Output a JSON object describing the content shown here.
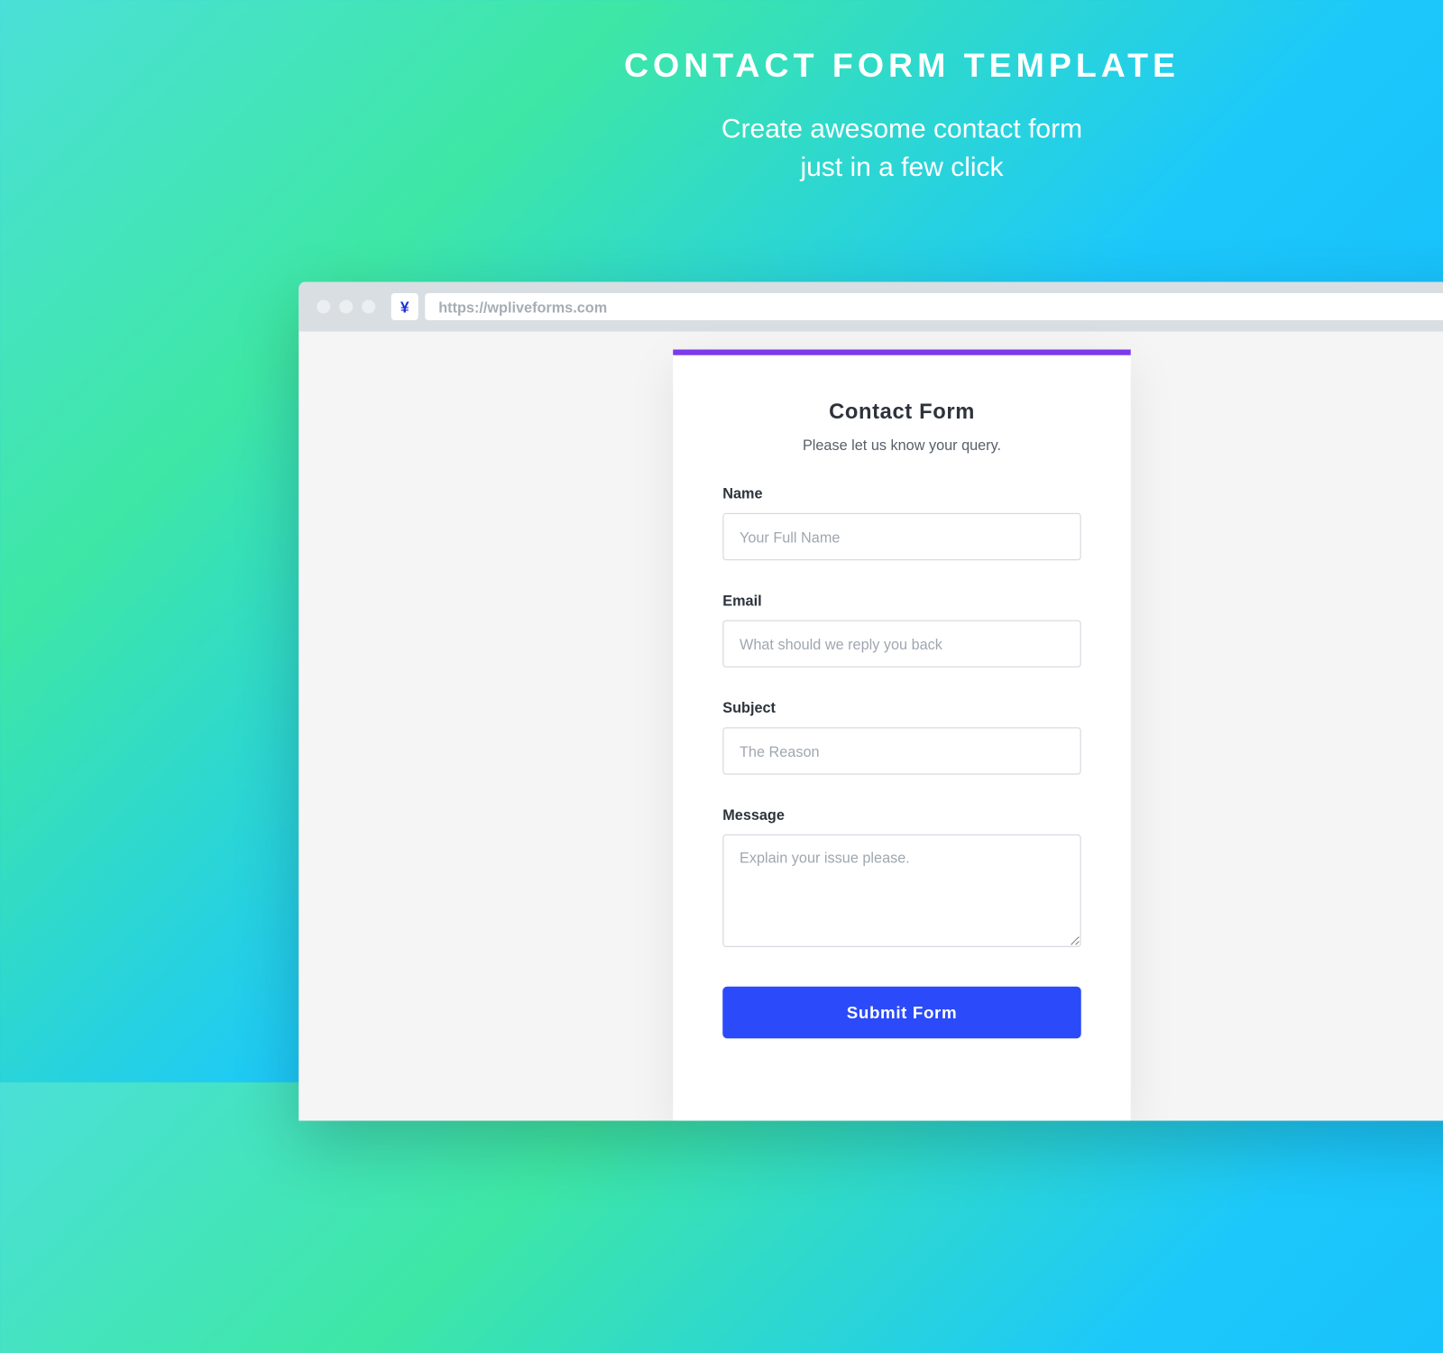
{
  "hero": {
    "title": "CONTACT FORM TEMPLATE",
    "subtitle_line1": "Create awesome contact form",
    "subtitle_line2": "just in a few click"
  },
  "browser": {
    "url": "https://wpliveforms.com",
    "favicon_glyph": "¥"
  },
  "form": {
    "title": "Contact Form",
    "subtitle": "Please let us know your query.",
    "fields": {
      "name": {
        "label": "Name",
        "placeholder": "Your Full Name",
        "value": ""
      },
      "email": {
        "label": "Email",
        "placeholder": "What should we reply you back",
        "value": ""
      },
      "subject": {
        "label": "Subject",
        "placeholder": "The Reason",
        "value": ""
      },
      "message": {
        "label": "Message",
        "placeholder": "Explain your issue please.",
        "value": ""
      }
    },
    "submit_label": "Submit Form"
  },
  "colors": {
    "accent_bar": "#7c3aed",
    "submit_bg": "#2b4af9"
  }
}
